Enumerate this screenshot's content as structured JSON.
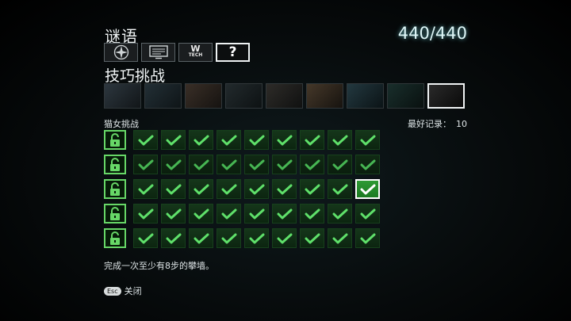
{
  "header": {
    "title": "谜语",
    "score": "440/440"
  },
  "tabs": [
    {
      "icon": "compass-icon",
      "active": false
    },
    {
      "icon": "monitor-icon",
      "active": false
    },
    {
      "icon": "wtech-icon",
      "label": "W",
      "sublabel": "TECH",
      "active": false
    },
    {
      "icon": "question-icon",
      "label": "?",
      "active": true
    }
  ],
  "section_title": "技巧挑战",
  "thumbnails": [
    {
      "name": "thumb-1",
      "colors": [
        "#3a4650",
        "#15191c"
      ]
    },
    {
      "name": "thumb-2",
      "colors": [
        "#2c3b43",
        "#11171a"
      ]
    },
    {
      "name": "thumb-3",
      "colors": [
        "#4a3a2f",
        "#1a1410"
      ]
    },
    {
      "name": "thumb-4",
      "colors": [
        "#2b3336",
        "#0e1213"
      ]
    },
    {
      "name": "thumb-5",
      "colors": [
        "#3a3530",
        "#121110"
      ]
    },
    {
      "name": "thumb-6",
      "colors": [
        "#5a4632",
        "#1b140e"
      ]
    },
    {
      "name": "thumb-7",
      "colors": [
        "#2c4750",
        "#0c1518"
      ]
    },
    {
      "name": "thumb-8",
      "colors": [
        "#1f3a36",
        "#0a1210"
      ]
    },
    {
      "name": "thumb-9",
      "colors": [
        "#2a2a2a",
        "#0a0a0a"
      ],
      "selected": true
    }
  ],
  "challenge": {
    "name": "猫女挑战",
    "best_label": "最好记录：",
    "best_value": "10",
    "rows": 5,
    "cols": 9,
    "highlight": {
      "row": 2,
      "col": 8
    },
    "description": "完成一次至少有8步的攀墙。"
  },
  "footer": {
    "key": "Esc",
    "label": "关闭"
  },
  "colors": {
    "check": "#5fe06a",
    "check_dim": "#47b653",
    "lock": "#67d767"
  }
}
